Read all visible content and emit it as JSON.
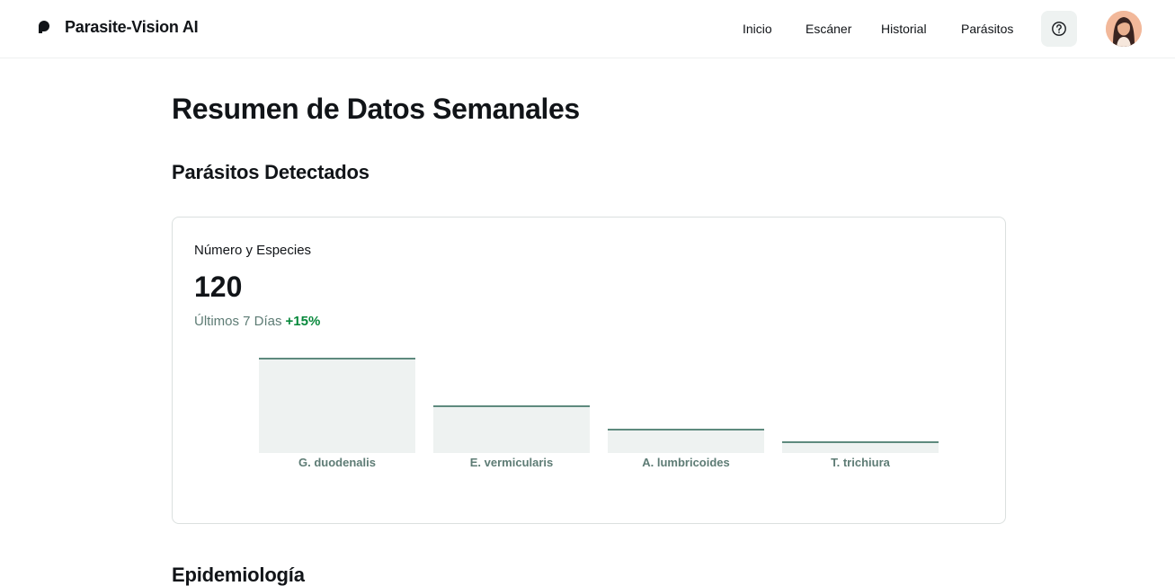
{
  "header": {
    "brand": "Parasite-Vision AI",
    "nav": [
      "Inicio",
      "Escáner",
      "Historial",
      "Parásitos"
    ]
  },
  "page": {
    "title": "Resumen de Datos Semanales",
    "section1": "Parásitos Detectados",
    "section2": "Epidemiología"
  },
  "card": {
    "label": "Número y Especies",
    "value": "120",
    "period": "Últimos 7 Días",
    "change": "+15%"
  },
  "chart_data": {
    "type": "bar",
    "categories": [
      "G. duodenalis",
      "E. vermicularis",
      "A. lumbricoides",
      "T. trichiura"
    ],
    "values": [
      100,
      50,
      25,
      12
    ],
    "ylim": [
      0,
      100
    ],
    "grid": false,
    "bar_color": "#eef2f1",
    "bar_top_color": "#5e8a7e"
  },
  "icons": {
    "logo": "parasite-logo-icon",
    "help": "question-circle-icon",
    "avatar": "user-avatar"
  }
}
